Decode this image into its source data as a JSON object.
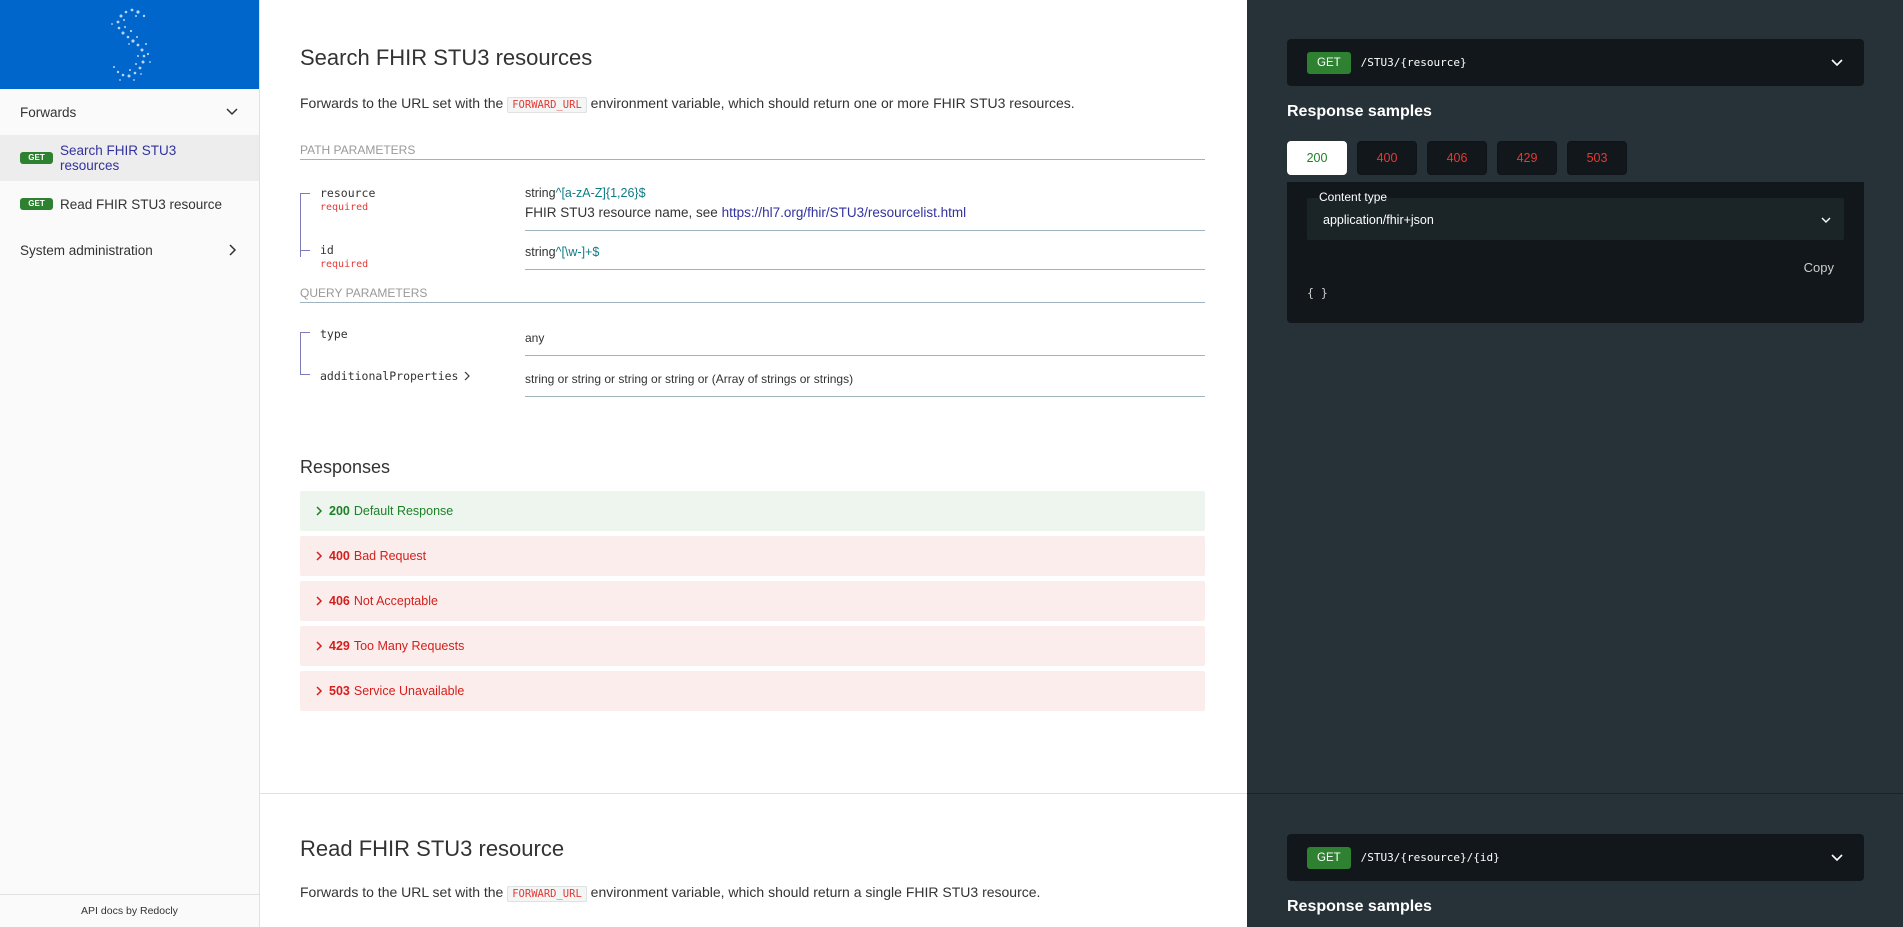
{
  "sidebar": {
    "items": [
      {
        "label": "Forwards",
        "expanded": true
      },
      {
        "badge": "GET",
        "label": "Search FHIR STU3 resources",
        "active": true
      },
      {
        "badge": "GET",
        "label": "Read FHIR STU3 resource"
      },
      {
        "label": "System administration",
        "expanded": false
      }
    ],
    "footer": "API docs by Redocly"
  },
  "operations": [
    {
      "title": "Search FHIR STU3 resources",
      "desc_before": "Forwards to the URL set with the ",
      "desc_code": "FORWARD_URL",
      "desc_after": " environment variable, which should return one or more FHIR STU3 resources.",
      "path_params_header": "PATH PARAMETERS",
      "path_params": [
        {
          "name": "resource",
          "required": "required",
          "type": "string",
          "pattern": "^[a-zA-Z]{1,26}$",
          "desc_text": "FHIR STU3 resource name, see ",
          "desc_link": "https://hl7.org/fhir/STU3/resourcelist.html"
        },
        {
          "name": "id",
          "required": "required",
          "type": "string",
          "pattern": "^[\\w-]+$"
        }
      ],
      "query_params_header": "QUERY PARAMETERS",
      "query_params": [
        {
          "name": "type",
          "type": "any"
        },
        {
          "name": "additionalProperties",
          "type": "string or string or string or string or (Array of strings or strings)"
        }
      ],
      "responses_title": "Responses",
      "responses": [
        {
          "code": "200",
          "label": "Default Response",
          "status": "success"
        },
        {
          "code": "400",
          "label": "Bad Request",
          "status": "error"
        },
        {
          "code": "406",
          "label": "Not Acceptable",
          "status": "error"
        },
        {
          "code": "429",
          "label": "Too Many Requests",
          "status": "error"
        },
        {
          "code": "503",
          "label": "Service Unavailable",
          "status": "error"
        }
      ],
      "endpoint": {
        "method": "GET",
        "path": "/STU3/{resource}"
      },
      "samples_title": "Response samples",
      "sample_tabs": [
        "200",
        "400",
        "406",
        "429",
        "503"
      ],
      "content_type_label": "Content type",
      "content_type": "application/fhir+json",
      "copy_label": "Copy",
      "sample_body": "{ }"
    },
    {
      "title": "Read FHIR STU3 resource",
      "desc_before": "Forwards to the URL set with the ",
      "desc_code": "FORWARD_URL",
      "desc_after": " environment variable, which should return a single FHIR STU3 resource.",
      "endpoint": {
        "method": "GET",
        "path": "/STU3/{resource}/{id}"
      },
      "samples_title": "Response samples"
    }
  ],
  "colors": {
    "brand": "#0066cc",
    "get": "#2f8132",
    "success": "#1d8127",
    "error": "#d41f1c",
    "panel": "#263238"
  }
}
